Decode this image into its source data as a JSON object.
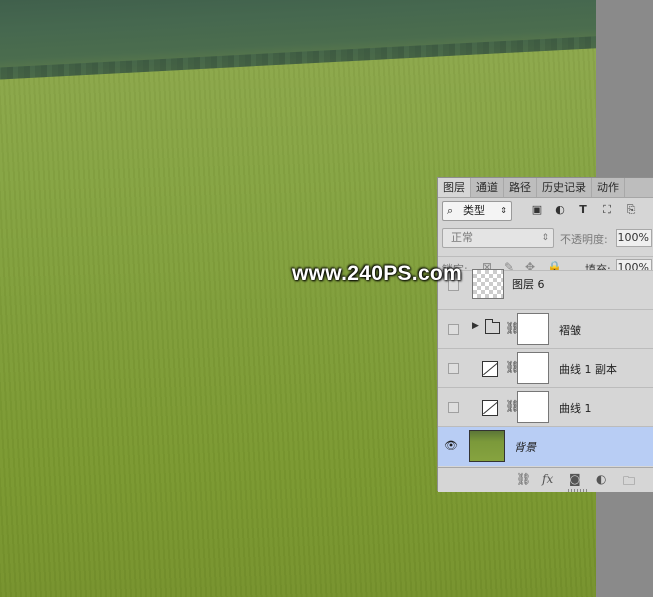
{
  "watermark": "www.240PS.com",
  "panel": {
    "tabs": [
      "图层",
      "通道",
      "路径",
      "历史记录",
      "动作"
    ],
    "active_tab": "图层",
    "filter": {
      "kind_label": "类型",
      "icons": [
        "image-filter-icon",
        "adjustment-filter-icon",
        "type-filter-icon",
        "shape-filter-icon",
        "smart-object-filter-icon"
      ]
    },
    "blend_mode": "正常",
    "opacity_label": "不透明度:",
    "opacity_value": "100%",
    "lock_label": "锁定:",
    "fill_label": "填充:",
    "fill_value": "100%",
    "layers": [
      {
        "name": "图层 6",
        "visible": false,
        "type": "pixel"
      },
      {
        "name": "褶皱",
        "visible": false,
        "type": "group"
      },
      {
        "name": "曲线 1 副本",
        "visible": false,
        "type": "adjustment"
      },
      {
        "name": "曲线 1",
        "visible": false,
        "type": "adjustment"
      },
      {
        "name": "背景",
        "visible": true,
        "type": "background",
        "selected": true
      }
    ],
    "bottom_icons": [
      "link-layers-icon",
      "fx-icon",
      "add-mask-icon",
      "adjustment-layer-icon",
      "new-group-icon"
    ]
  },
  "colors": {
    "selected_row": "#b8cdf4",
    "panel_bg": "#d6d6d6"
  }
}
